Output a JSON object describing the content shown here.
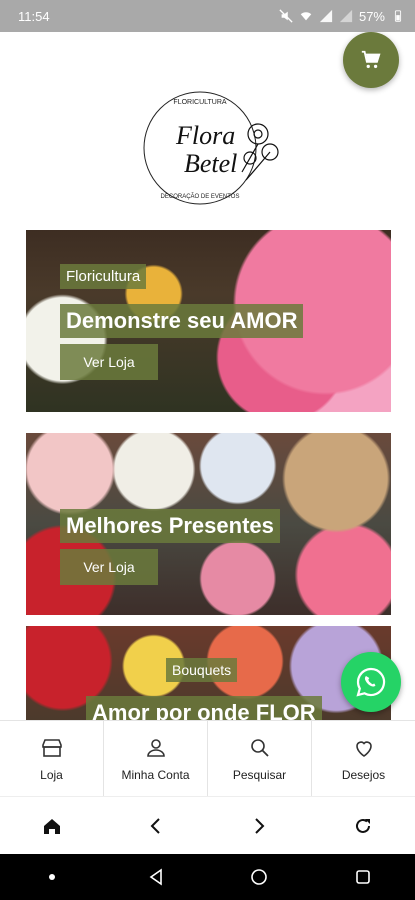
{
  "status": {
    "time": "11:54",
    "battery": "57%"
  },
  "logo": {
    "line1": "Flora",
    "line2": "Betel",
    "top_text": "FLORICULTURA",
    "bottom_text": "DECORAÇÃO DE EVENTOS"
  },
  "banners": [
    {
      "small": "Floricultura",
      "title": "Demonstre seu AMOR",
      "button": "Ver Loja"
    },
    {
      "title": "Melhores Presentes",
      "button": "Ver Loja"
    },
    {
      "small": "Bouquets",
      "title": "Amor por onde FLOR"
    }
  ],
  "tabs": [
    {
      "label": "Loja",
      "icon": "store-icon"
    },
    {
      "label": "Minha Conta",
      "icon": "user-icon"
    },
    {
      "label": "Pesquisar",
      "icon": "search-icon"
    },
    {
      "label": "Desejos",
      "icon": "heart-icon"
    }
  ],
  "colors": {
    "accent": "#6b7a3c",
    "whatsapp": "#25d366"
  }
}
